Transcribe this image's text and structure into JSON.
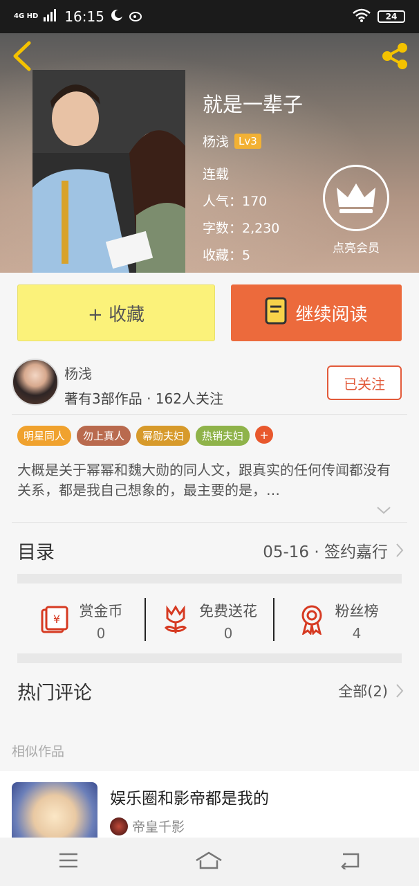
{
  "status_bar": {
    "network": "4G HD",
    "time": "16:15",
    "battery": "24"
  },
  "hero": {
    "title": "就是一辈子",
    "author": "杨浅",
    "level": "Lv3",
    "status": "连载",
    "popularity": "人气：170",
    "word_count": "字数：2,230",
    "favorites": "收藏：5",
    "vip_label": "点亮会员"
  },
  "actions": {
    "collect_label": "+ 收藏",
    "read_label": "继续阅读"
  },
  "author_block": {
    "name": "杨浅",
    "stats": "著有3部作品 · 162人关注",
    "follow_label": "已关注"
  },
  "tags": [
    {
      "label": "明星同人",
      "color": "#f0a22e"
    },
    {
      "label": "勿上真人",
      "color": "#b96a4e"
    },
    {
      "label": "幂勋夫妇",
      "color": "#d79a2b"
    },
    {
      "label": "热销夫妇",
      "color": "#8fb34a"
    }
  ],
  "tag_more": "+",
  "summary": "大概是关于幂幂和魏大勋的同人文，跟真实的任何传闻都没有关系，都是我自己想象的，最主要的是，…",
  "catalog": {
    "title": "目录",
    "latest": "05-16 · 签约嘉行"
  },
  "stats": [
    {
      "label": "赏金币",
      "value": "0",
      "icon": "red-envelope-icon"
    },
    {
      "label": "免费送花",
      "value": "0",
      "icon": "flower-icon"
    },
    {
      "label": "粉丝榜",
      "value": "4",
      "icon": "medal-icon"
    }
  ],
  "hot_comments": {
    "title": "热门评论",
    "all_label": "全部(2)"
  },
  "similar": {
    "section_label": "相似作品",
    "items": [
      {
        "title": "娱乐圈和影帝都是我的",
        "author": "帝皇千影"
      }
    ]
  },
  "colors": {
    "accent_orange": "#ec6a3c",
    "collect_yellow": "#fbf27a",
    "follow_red": "#e25a3a"
  }
}
